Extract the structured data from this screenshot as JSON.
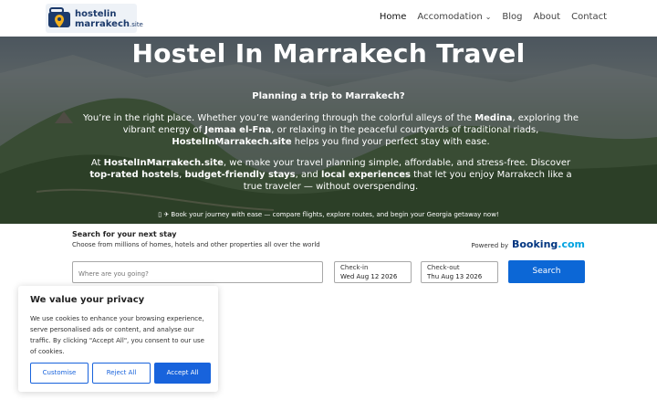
{
  "header": {
    "logo": {
      "line1": "hostelin",
      "line2": "marrakech",
      "line2_suffix": ".site"
    },
    "nav": [
      {
        "label": "Home",
        "active": true
      },
      {
        "label": "Accomodation",
        "dropdown": true
      },
      {
        "label": "Blog"
      },
      {
        "label": "About"
      },
      {
        "label": "Contact"
      }
    ]
  },
  "hero": {
    "title": "Hostel In Marrakech Travel",
    "subtitle": "Planning a trip to Marrakech?",
    "p1": {
      "t1": "You’re in the right place. Whether you’re wandering through the colorful alleys of the ",
      "b1": "Medina",
      "t2": ", exploring the vibrant energy of ",
      "b2": "Jemaa el-Fna",
      "t3": ", or relaxing in the peaceful courtyards of traditional riads, ",
      "b3": "HostelInMarrakech.site",
      "t4": " helps you find your perfect stay with ease."
    },
    "p2": {
      "t1": "At ",
      "b1": "HostelInMarrakech.site",
      "t2": ", we make your travel planning simple, affordable, and stress-free. Discover ",
      "b2": "top-rated hostels",
      "t3": ", ",
      "b3": "budget-friendly stays",
      "t4": ", and ",
      "b4": "local experiences",
      "t5": " that let you enjoy Marrakech like a true traveler — without overspending."
    },
    "cta": "▯ ✈ Book your journey with ease — compare flights, explore routes, and begin your Georgia getaway now!"
  },
  "search": {
    "title": "Search for your next stay",
    "description": "Choose from millions of homes, hotels and other properties all over the world",
    "powered_label": "Powered by",
    "brand_main": "Booking",
    "brand_suffix": ".com",
    "destination_placeholder": "Where are you going?",
    "checkin_label": "Check-in",
    "checkin_value": "Wed Aug 12 2026",
    "checkout_label": "Check-out",
    "checkout_value": "Thu Aug 13 2026",
    "button": "Search"
  },
  "cookie": {
    "title": "We value your privacy",
    "text": "We use cookies to enhance your browsing experience, serve personalised ads or content, and analyse our traffic. By clicking \"Accept All\", you consent to our use of cookies.",
    "customise": "Customise",
    "reject": "Reject All",
    "accept": "Accept All"
  },
  "colors": {
    "brand_navy": "#1c3a6b",
    "search_button": "#0c67d6",
    "cookie_accent": "#1863dc",
    "booking_blue": "#003580"
  }
}
